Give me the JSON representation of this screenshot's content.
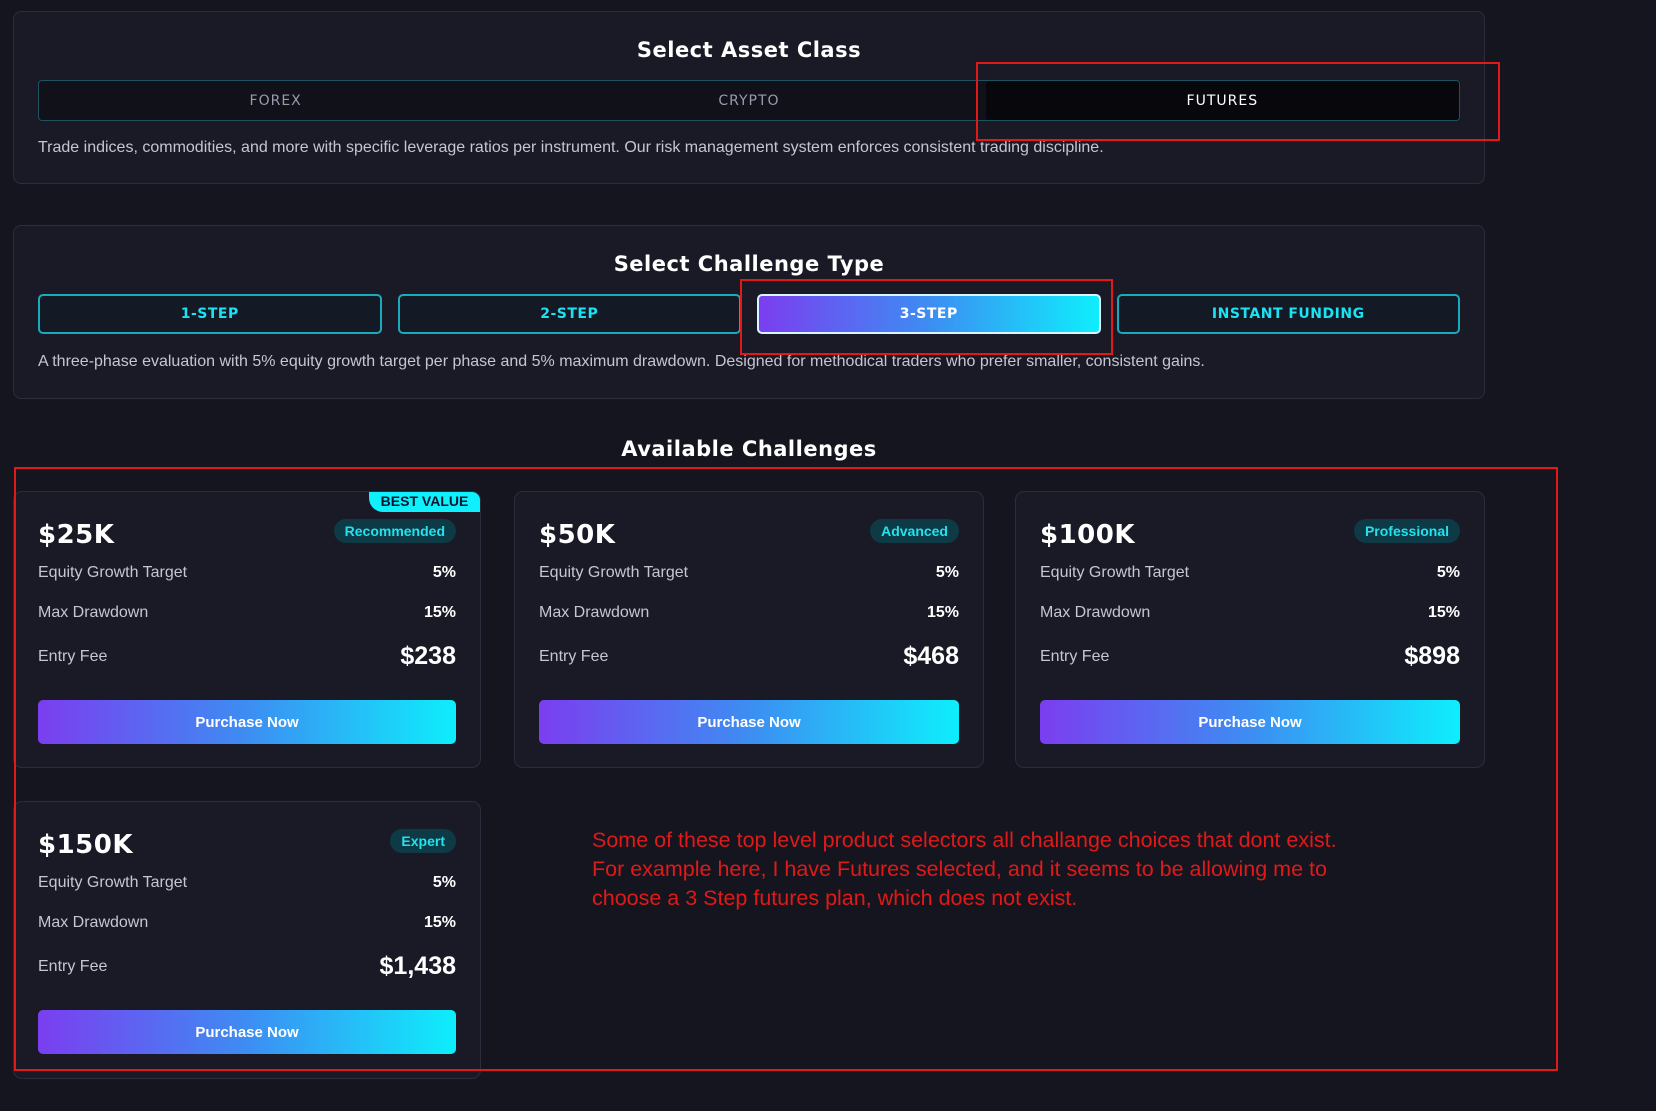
{
  "asset_class": {
    "title": "Select Asset Class",
    "tabs": [
      {
        "label": "FOREX"
      },
      {
        "label": "CRYPTO"
      },
      {
        "label": "FUTURES"
      }
    ],
    "selected": "FUTURES",
    "description": "Trade indices, commodities, and more with specific leverage ratios per instrument. Our risk management system enforces consistent trading discipline."
  },
  "challenge_type": {
    "title": "Select Challenge Type",
    "buttons": [
      {
        "label": "1-STEP"
      },
      {
        "label": "2-STEP"
      },
      {
        "label": "3-STEP"
      },
      {
        "label": "INSTANT FUNDING"
      }
    ],
    "selected": "3-STEP",
    "description": "A three-phase evaluation with 5% equity growth target per phase and 5% maximum drawdown. Designed for methodical traders who prefer smaller, consistent gains."
  },
  "available": {
    "title": "Available Challenges",
    "cards": [
      {
        "amount": "$25K",
        "badge": "Recommended",
        "ribbon": "BEST VALUE",
        "growth_label": "Equity Growth Target",
        "growth_value": "5%",
        "drawdown_label": "Max Drawdown",
        "drawdown_value": "15%",
        "fee_label": "Entry Fee",
        "fee_value": "$238",
        "button": "Purchase Now"
      },
      {
        "amount": "$50K",
        "badge": "Advanced",
        "growth_label": "Equity Growth Target",
        "growth_value": "5%",
        "drawdown_label": "Max Drawdown",
        "drawdown_value": "15%",
        "fee_label": "Entry Fee",
        "fee_value": "$468",
        "button": "Purchase Now"
      },
      {
        "amount": "$100K",
        "badge": "Professional",
        "growth_label": "Equity Growth Target",
        "growth_value": "5%",
        "drawdown_label": "Max Drawdown",
        "drawdown_value": "15%",
        "fee_label": "Entry Fee",
        "fee_value": "$898",
        "button": "Purchase Now"
      },
      {
        "amount": "$150K",
        "badge": "Expert",
        "growth_label": "Equity Growth Target",
        "growth_value": "5%",
        "drawdown_label": "Max Drawdown",
        "drawdown_value": "15%",
        "fee_label": "Entry Fee",
        "fee_value": "$1,438",
        "button": "Purchase Now"
      }
    ]
  },
  "annotation": {
    "lines": [
      "Some of these top level product selectors all challange choices that dont exist.",
      "For example here, I have Futures selected, and it seems to be allowing me to",
      "choose a 3 Step futures plan, which does not exist."
    ],
    "color": "#e01919"
  },
  "colors": {
    "accent_cyan": "#0eeefc",
    "accent_purple": "#7b3ef0",
    "background": "#15151f",
    "panel": "#1a1a27"
  }
}
